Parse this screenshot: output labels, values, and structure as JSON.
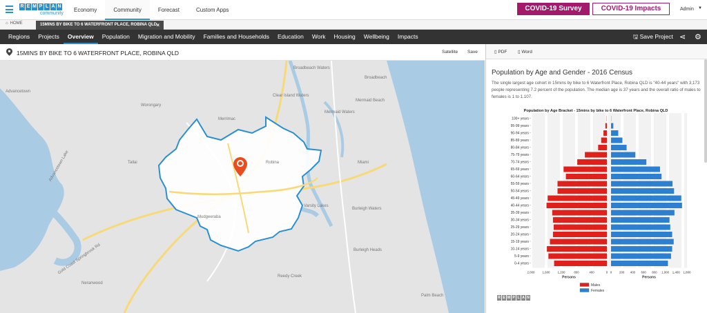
{
  "header": {
    "logo_blocks": [
      "R",
      "E",
      "M",
      "P",
      "L",
      "A",
      "N"
    ],
    "logo_sub": "community",
    "nav": [
      "Economy",
      "Community",
      "Forecast",
      "Custom Apps"
    ],
    "active_nav": "Community",
    "covid_survey": "COVID-19 Survey",
    "covid_impacts": "COVID-19 Impacts",
    "admin": "Admin",
    "brand_color": "#a3196c",
    "accent_color": "#2a8fce"
  },
  "tabs": {
    "home": "HOME",
    "area": "15MINS BY BIKE TO 6 WATERFRONT PLACE, ROBINA QLD"
  },
  "mainnav": {
    "links": [
      "Regions",
      "Projects",
      "Overview",
      "Population",
      "Migration and Mobility",
      "Families and Households",
      "Education",
      "Work",
      "Housing",
      "Wellbeing",
      "Impacts"
    ],
    "active": "Overview",
    "save_project": "Save Project"
  },
  "map": {
    "title": "15MINS BY BIKE TO 6 WATERFRONT PLACE, ROBINA QLD",
    "satellite": "Satellite",
    "save": "Save",
    "labels": {
      "advancetown": "Advancetown",
      "broadbeach_waters": "Broadbeach Waters",
      "broadbeach": "Broadbeach",
      "clear_island_waters": "Clear Island Waters",
      "mermaid_waters": "Mermaid Waters",
      "mermaid_beach": "Mermaid Beach",
      "worongary": "Worongary",
      "merrimac": "Merrimac",
      "robina": "Robina",
      "tallai": "Tallai",
      "miami": "Miami",
      "mudgeeraba": "Mudgeeraba",
      "varsity_lakes": "Varsity Lakes",
      "burleigh_waters": "Burleigh Waters",
      "burleigh_heads": "Burleigh Heads",
      "neranwood": "Neranwood",
      "reedy_creek": "Reedy Creek",
      "palm_beach": "Palm Beach",
      "gold_coast_springbrook_rd": "Gold Coast Springbrook Rd",
      "advancetown_lake": "Advancetown Lake"
    }
  },
  "report": {
    "pdf": "PDF",
    "word": "Word",
    "title": "Population by Age and Gender - 2016 Census",
    "text": "The single largest age cohort in 15mins by bike to 6 Waterfront Place, Robina QLD is \"40-44 years\" with 3,173 people representing 7.2 percent of the population. The median age is 37 years and the overall ratio of males to females is 1 to 1.107.",
    "remplan": [
      "R",
      "E",
      "M",
      "P",
      "L",
      "A",
      "N"
    ]
  },
  "chart_data": {
    "type": "bar",
    "title": "Population by Age Bracket - 15mins by bike to 6 Waterfront Place, Robina QLD",
    "categories": [
      "100+ years",
      "95-99 years",
      "90-94 years",
      "85-89 years",
      "80-84 years",
      "75-79 years",
      "70-74 years",
      "65-69 years",
      "60-64 years",
      "55-59 years",
      "50-54 years",
      "45-49 years",
      "40-44 years",
      "35-39 years",
      "30-34 years",
      "25-29 years",
      "20-24 years",
      "15-19 years",
      "10-14 years",
      "5-9 years",
      "0-4 years"
    ],
    "series": [
      {
        "name": "Males",
        "color": "#e0201b",
        "values": [
          5,
          40,
          90,
          150,
          230,
          580,
          780,
          1140,
          1080,
          1300,
          1300,
          1560,
          1590,
          1440,
          1420,
          1400,
          1420,
          1500,
          1580,
          1540,
          1390
        ]
      },
      {
        "name": "Females",
        "color": "#2d7fd0",
        "values": [
          5,
          60,
          190,
          300,
          410,
          640,
          930,
          1290,
          1330,
          1620,
          1660,
          1850,
          1870,
          1670,
          1540,
          1560,
          1610,
          1650,
          1610,
          1580,
          1500
        ]
      }
    ],
    "xlabel_left": "Persons",
    "xlabel_right": "Persons",
    "xticks_left": [
      "2,000",
      "1,600",
      "1,200",
      "800",
      "400",
      "0"
    ],
    "xticks_right": [
      "0",
      "200",
      "400",
      "600",
      "800",
      "1,000",
      "1,400",
      "1,800"
    ],
    "xlim": [
      0,
      2000
    ],
    "legend_position": "bottom-left"
  }
}
